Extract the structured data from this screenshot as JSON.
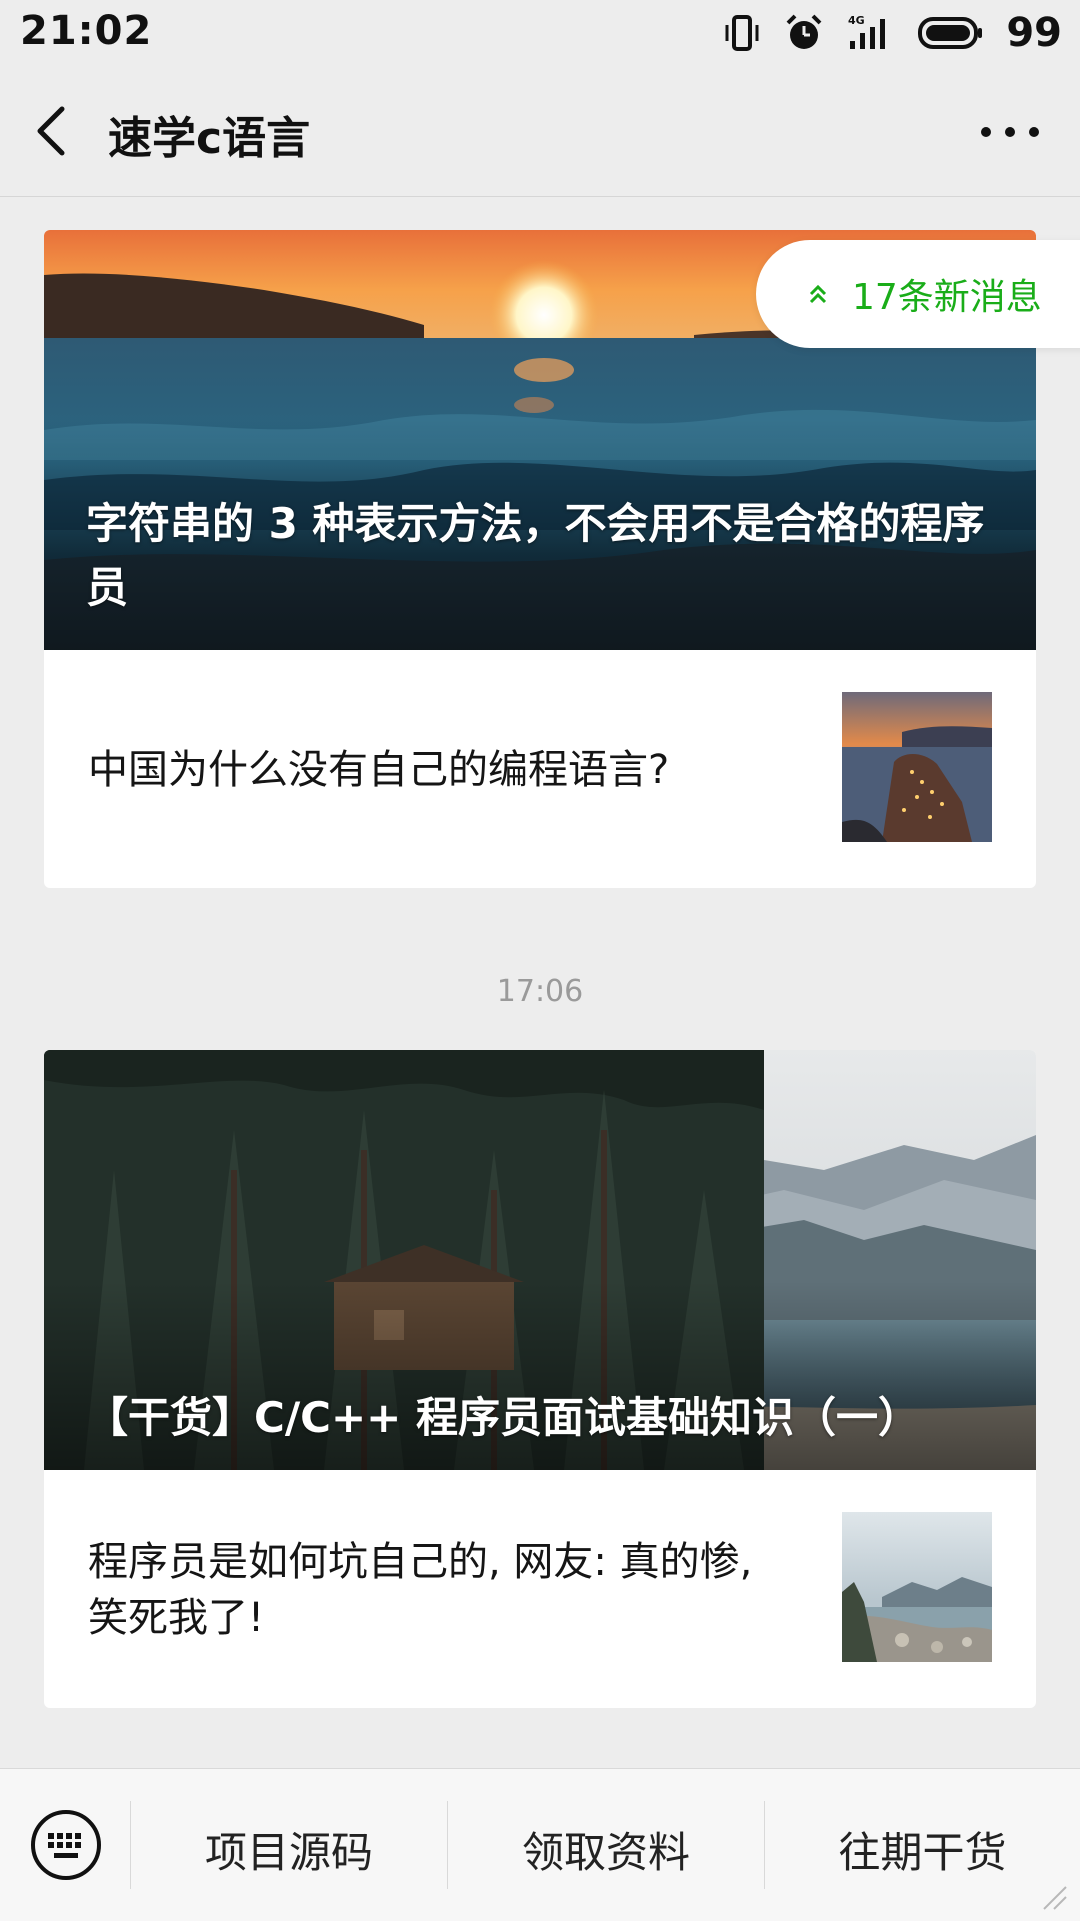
{
  "status_bar": {
    "time": "21:02",
    "battery": "99",
    "network": "4G",
    "icons": [
      "vibrate-icon",
      "alarm-icon",
      "signal-icon",
      "battery-icon"
    ]
  },
  "header": {
    "title": "速学c语言",
    "back_icon": "chevron-left-icon",
    "more_icon": "more-icon"
  },
  "new_messages": {
    "label": "17条新消息",
    "icon": "double-chevron-up-icon",
    "color": "#1aad19"
  },
  "messages": [
    {
      "cover_title": "字符串的 3 种表示方法，不会用不是合格的程序员",
      "sub_title": "中国为什么没有自己的编程语言?"
    },
    {
      "timestamp": "17:06",
      "cover_title": "【干货】C/C++ 程序员面试基础知识（一）",
      "sub_title": "程序员是如何坑自己的, 网友: 真的惨, 笑死我了!"
    }
  ],
  "bottom_menu": {
    "keyboard_icon": "keyboard-icon",
    "items": [
      "项目源码",
      "领取资料",
      "往期干货"
    ]
  }
}
